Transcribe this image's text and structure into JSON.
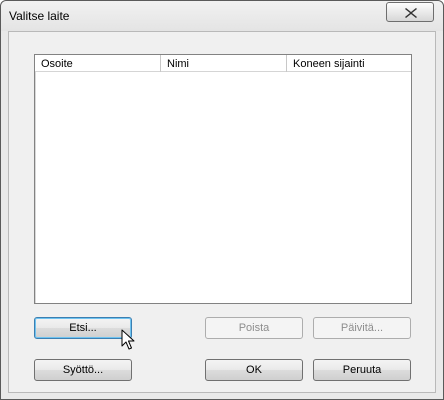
{
  "window": {
    "title": "Valitse laite"
  },
  "device_list": {
    "columns": [
      "Osoite",
      "Nimi",
      "Koneen sijainti"
    ],
    "rows": []
  },
  "buttons": {
    "search": "Etsi...",
    "remove": "Poista",
    "update": "Päivitä...",
    "input": "Syöttö...",
    "ok": "OK",
    "cancel": "Peruuta"
  },
  "icons": {
    "close": "close-icon",
    "cursor": "mouse-pointer-icon"
  }
}
